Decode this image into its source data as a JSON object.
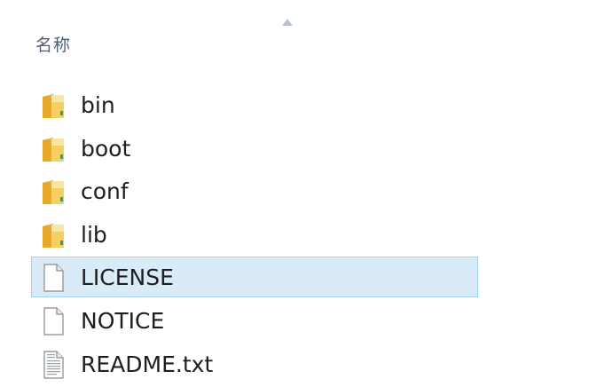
{
  "header": {
    "column_name": "名称",
    "sort_indicator": "sort-ascending-icon"
  },
  "files": [
    {
      "name": "bin",
      "icon": "folder-icon",
      "selected": false
    },
    {
      "name": "boot",
      "icon": "folder-icon",
      "selected": false
    },
    {
      "name": "conf",
      "icon": "folder-icon",
      "selected": false
    },
    {
      "name": "lib",
      "icon": "folder-icon",
      "selected": false
    },
    {
      "name": "LICENSE",
      "icon": "file-icon",
      "selected": true
    },
    {
      "name": "NOTICE",
      "icon": "file-icon",
      "selected": false
    },
    {
      "name": "README.txt",
      "icon": "text-file-icon",
      "selected": false
    }
  ],
  "colors": {
    "selection_bg": "#d9ebf7",
    "selection_border": "#a7d0ec",
    "folder_yellow": "#e8b43a",
    "header_text": "#4c607a"
  }
}
